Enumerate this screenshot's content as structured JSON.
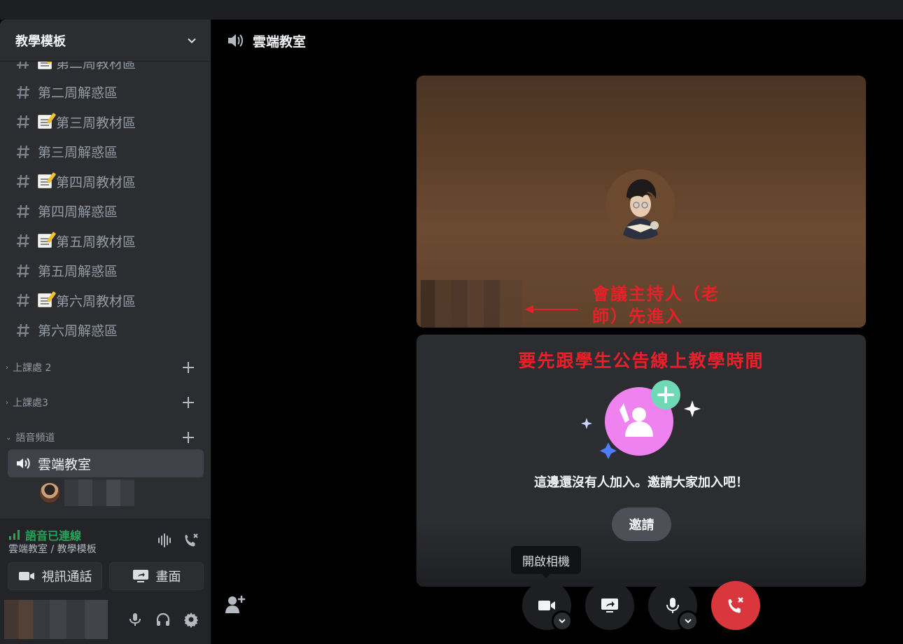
{
  "server": {
    "name": "教學模板"
  },
  "channels": [
    {
      "label": "第二周教材區",
      "memo": true
    },
    {
      "label": "第二周解惑區",
      "memo": false
    },
    {
      "label": "第三周教材區",
      "memo": true
    },
    {
      "label": "第三周解惑區",
      "memo": false
    },
    {
      "label": "第四周教材區",
      "memo": true
    },
    {
      "label": "第四周解惑區",
      "memo": false
    },
    {
      "label": "第五周教材區",
      "memo": true
    },
    {
      "label": "第五周解惑區",
      "memo": false
    },
    {
      "label": "第六周教材區",
      "memo": true
    },
    {
      "label": "第六周解惑區",
      "memo": false
    }
  ],
  "categories": [
    {
      "label": "上課處 2",
      "caret": "›"
    },
    {
      "label": "上課處3",
      "caret": "›"
    },
    {
      "label": "語音頻道",
      "caret": "⌄"
    }
  ],
  "voice_channel": {
    "label": "雲端教室"
  },
  "voice_panel": {
    "status": "語音已連線",
    "location": "雲端教室 / 教學模板",
    "video_label": "視訊通話",
    "screen_label": "畫面"
  },
  "main": {
    "title": "雲端教室",
    "annotation_host": "會議主持人（老師）先進入",
    "annotation_notice": "要先跟學生公告線上教學時間",
    "empty_message": "這邊還沒有人加入。邀請大家加入吧！",
    "invite_label": "邀請",
    "camera_tooltip": "開啟相機"
  },
  "colors": {
    "accent_green": "#23a55a",
    "hangup_red": "#da373c",
    "annotation_red": "#e8202a",
    "invite_pink": "#ee82ee",
    "invite_teal": "#6fd9b6"
  }
}
